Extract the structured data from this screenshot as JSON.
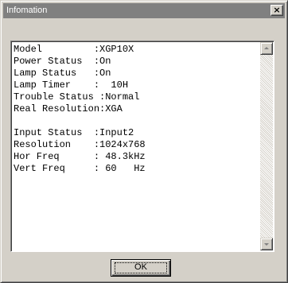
{
  "window": {
    "title": "Infomation",
    "close_glyph": "×"
  },
  "info": {
    "lines": [
      "Model         :XGP10X",
      "Power Status  :On",
      "Lamp Status   :On",
      "Lamp Timer    :  10H",
      "Trouble Status :Normal",
      "Real Resolution:XGA",
      "",
      "Input Status  :Input2",
      "Resolution    :1024x768",
      "Hor Freq      : 48.3kHz",
      "Vert Freq     : 60   Hz"
    ]
  },
  "buttons": {
    "ok_label": "OK"
  },
  "icons": {
    "close": "close-icon",
    "scroll_up": "arrow-up-icon",
    "scroll_down": "arrow-down-icon"
  },
  "colors": {
    "titlebar": "#808080",
    "face": "#d4d0c8",
    "text_bg": "#ffffff"
  }
}
